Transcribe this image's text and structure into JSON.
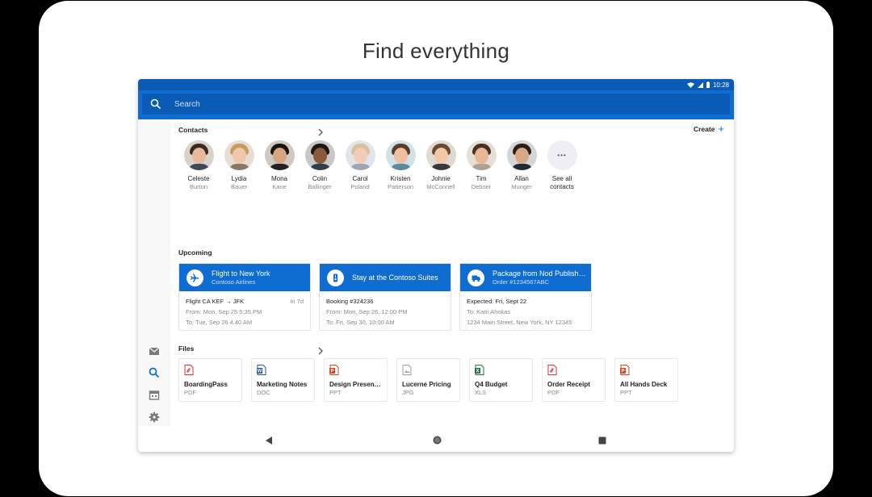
{
  "headline": "Find everything",
  "status": {
    "time": "10:28"
  },
  "search": {
    "placeholder": "Search"
  },
  "contacts": {
    "title": "Contacts",
    "create_label": "Create",
    "items": [
      {
        "first": "Celeste",
        "last": "Burton",
        "skin": "#e6b99a",
        "hair": "#3b2a20",
        "bg": "#d9d2c8",
        "shirt": "#3a4a5a"
      },
      {
        "first": "Lydia",
        "last": "Bauer",
        "skin": "#f0c7ac",
        "hair": "#c79a5e",
        "bg": "#e6ded3",
        "shirt": "#8b7766"
      },
      {
        "first": "Mona",
        "last": "Kane",
        "skin": "#d9a57f",
        "hair": "#1a1410",
        "bg": "#cfc9c2",
        "shirt": "#222222"
      },
      {
        "first": "Colin",
        "last": "Ballinger",
        "skin": "#8a5a3c",
        "hair": "#1f1712",
        "bg": "#c8c8c8",
        "shirt": "#2d3e50"
      },
      {
        "first": "Carol",
        "last": "Poland",
        "skin": "#f1cdb5",
        "hair": "#d8c09a",
        "bg": "#dfe5ea",
        "shirt": "#9aa7b5"
      },
      {
        "first": "Kristen",
        "last": "Patterson",
        "skin": "#eebfa0",
        "hair": "#5a3b28",
        "bg": "#d0e2e8",
        "shirt": "#5b8a9a"
      },
      {
        "first": "Johnie",
        "last": "McConnell",
        "skin": "#f2c8aa",
        "hair": "#6a4a30",
        "bg": "#e0dad2",
        "shirt": "#3a3a3a"
      },
      {
        "first": "Tim",
        "last": "Deboer",
        "skin": "#e8b896",
        "hair": "#4a3020",
        "bg": "#e6dfd5",
        "shirt": "#b0a090"
      },
      {
        "first": "Allan",
        "last": "Munger",
        "skin": "#d9a986",
        "hair": "#2b1e16",
        "bg": "#d5d5d5",
        "shirt": "#1f2a38"
      }
    ],
    "see_all_line1": "See all",
    "see_all_line2": "contacts"
  },
  "upcoming": {
    "title": "Upcoming",
    "events": [
      {
        "icon": "airplane-icon",
        "title": "Flight to New York",
        "subtitle": "Contoso Airlines",
        "line1": "Flight CA KEF → JFK",
        "badge": "In 7d",
        "line2": "From: Mon, Sep 25 5:35 PM",
        "line3": "To: Tue, Sep 26 4:40 AM"
      },
      {
        "icon": "hotel-icon",
        "title": "Stay at the Contoso Suites",
        "subtitle": "",
        "line1": "Booking #324236",
        "badge": "",
        "line2": "From: Mon, Sep 26, 12:00 PM",
        "line3": "To: Fri, Sep 30, 10:00 AM"
      },
      {
        "icon": "delivery-truck-icon",
        "title": "Package from Nod Publishers",
        "subtitle": "Order #1234567ABC",
        "line1": "Expected: Fri, Sept 22",
        "badge": "",
        "line2": "To: Katri Ahokas",
        "line3": "1234 Main Street, New York, NY 12345"
      }
    ]
  },
  "files": {
    "title": "Files",
    "items": [
      {
        "name": "BoardingPass",
        "type": "PDF",
        "color": "#d13438",
        "letter": ""
      },
      {
        "name": "Marketing Notes",
        "type": "DOC",
        "color": "#2b579a",
        "letter": "W"
      },
      {
        "name": "Design Presentation",
        "type": "PPT",
        "color": "#d24726",
        "letter": "P"
      },
      {
        "name": "Lucerne Pricing",
        "type": "JPG",
        "color": "#9e9e9e",
        "letter": ""
      },
      {
        "name": "Q4 Budget",
        "type": "XLS",
        "color": "#217346",
        "letter": "X"
      },
      {
        "name": "Order Receipt",
        "type": "PDF",
        "color": "#d13438",
        "letter": ""
      },
      {
        "name": "All Hands Deck",
        "type": "PPT",
        "color": "#d24726",
        "letter": "P"
      }
    ]
  },
  "colors": {
    "brand": "#0f6cd0",
    "brand_dark": "#0a5bb5"
  }
}
